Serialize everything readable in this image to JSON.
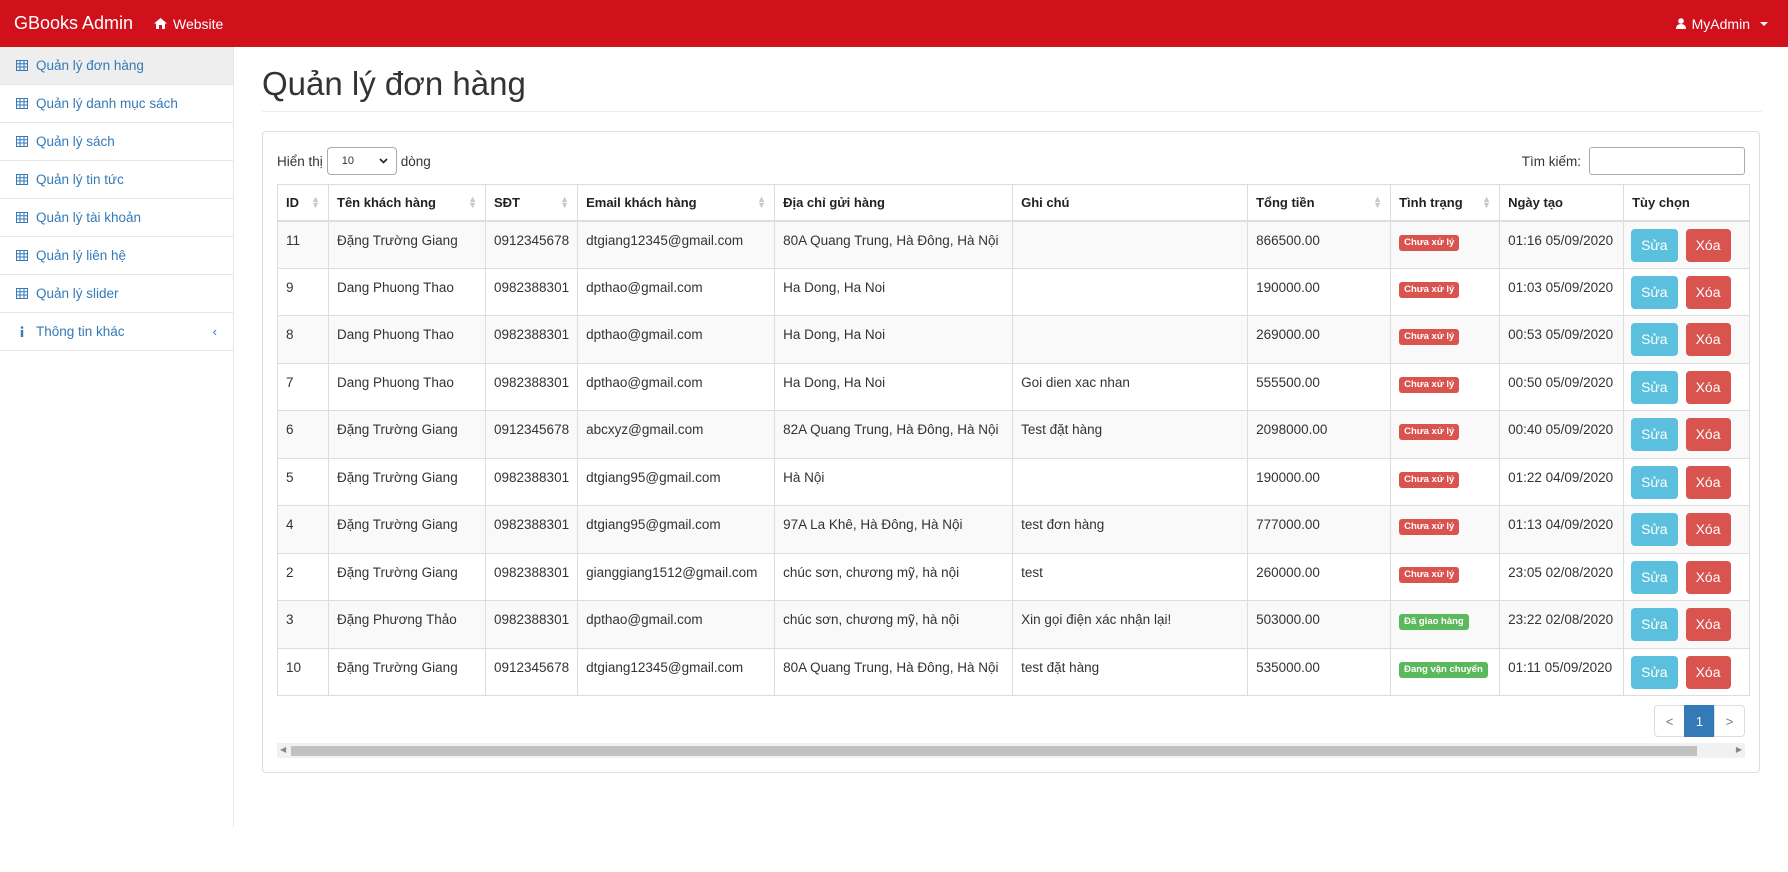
{
  "navbar": {
    "brand": "GBooks Admin",
    "website_label": "Website",
    "user_label": "MyAdmin"
  },
  "sidebar": {
    "items": [
      {
        "label": "Quản lý đơn hàng"
      },
      {
        "label": "Quản lý danh mục sách"
      },
      {
        "label": "Quản lý sách"
      },
      {
        "label": "Quản lý tin tức"
      },
      {
        "label": "Quản lý tài khoản"
      },
      {
        "label": "Quản lý liên hệ"
      },
      {
        "label": "Quản lý slider"
      },
      {
        "label": "Thông tin khác"
      }
    ]
  },
  "page": {
    "title": "Quản lý đơn hàng"
  },
  "table_controls": {
    "show_label": "Hiển thị",
    "length_value": "10",
    "rows_label": "dòng",
    "search_label": "Tìm kiếm:",
    "search_value": ""
  },
  "table": {
    "headers": [
      "ID",
      "Tên khách hàng",
      "SĐT",
      "Email khách hàng",
      "Địa chỉ gửi hàng",
      "Ghi chú",
      "Tổng tiền",
      "Tình trạng",
      "Ngày tạo",
      "Tùy chọn"
    ],
    "rows": [
      {
        "id": "11",
        "name": "Đặng Trường Giang",
        "phone": "0912345678",
        "email": "dtgiang12345@gmail.com",
        "address": "80A Quang Trung, Hà Đông, Hà Nội",
        "note": "",
        "total": "866500.00",
        "status": "Chưa xử lý",
        "status_color": "#d9534f",
        "date": "01:16 05/09/2020"
      },
      {
        "id": "9",
        "name": "Dang Phuong Thao",
        "phone": "0982388301",
        "email": "dpthao@gmail.com",
        "address": "Ha Dong, Ha Noi",
        "note": "",
        "total": "190000.00",
        "status": "Chưa xử lý",
        "status_color": "#d9534f",
        "date": "01:03 05/09/2020"
      },
      {
        "id": "8",
        "name": "Dang Phuong Thao",
        "phone": "0982388301",
        "email": "dpthao@gmail.com",
        "address": "Ha Dong, Ha Noi",
        "note": "",
        "total": "269000.00",
        "status": "Chưa xử lý",
        "status_color": "#d9534f",
        "date": "00:53 05/09/2020"
      },
      {
        "id": "7",
        "name": "Dang Phuong Thao",
        "phone": "0982388301",
        "email": "dpthao@gmail.com",
        "address": "Ha Dong, Ha Noi",
        "note": "Goi dien xac nhan",
        "total": "555500.00",
        "status": "Chưa xử lý",
        "status_color": "#d9534f",
        "date": "00:50 05/09/2020"
      },
      {
        "id": "6",
        "name": "Đặng Trường Giang",
        "phone": "0912345678",
        "email": "abcxyz@gmail.com",
        "address": "82A Quang Trung, Hà Đông, Hà Nội",
        "note": "Test đặt hàng",
        "total": "2098000.00",
        "status": "Chưa xử lý",
        "status_color": "#d9534f",
        "date": "00:40 05/09/2020"
      },
      {
        "id": "5",
        "name": "Đặng Trường Giang",
        "phone": "0982388301",
        "email": "dtgiang95@gmail.com",
        "address": "Hà Nội",
        "note": "",
        "total": "190000.00",
        "status": "Chưa xử lý",
        "status_color": "#d9534f",
        "date": "01:22 04/09/2020"
      },
      {
        "id": "4",
        "name": "Đặng Trường Giang",
        "phone": "0982388301",
        "email": "dtgiang95@gmail.com",
        "address": "97A La Khê, Hà Đông, Hà Nội",
        "note": "test đơn hàng",
        "total": "777000.00",
        "status": "Chưa xử lý",
        "status_color": "#d9534f",
        "date": "01:13 04/09/2020"
      },
      {
        "id": "2",
        "name": "Đặng Trường Giang",
        "phone": "0982388301",
        "email": "gianggiang1512@gmail.com",
        "address": "chúc sơn, chương mỹ, hà nội",
        "note": "test",
        "total": "260000.00",
        "status": "Chưa xử lý",
        "status_color": "#d9534f",
        "date": "23:05 02/08/2020"
      },
      {
        "id": "3",
        "name": "Đặng Phương Thảo",
        "phone": "0982388301",
        "email": "dpthao@gmail.com",
        "address": "chúc sơn, chương mỹ, hà nội",
        "note": "Xin gọi điện xác nhận lại!",
        "total": "503000.00",
        "status": "Đã giao hàng",
        "status_color": "#5cb85c",
        "date": "23:22 02/08/2020"
      },
      {
        "id": "10",
        "name": "Đặng Trường Giang",
        "phone": "0912345678",
        "email": "dtgiang12345@gmail.com",
        "address": "80A Quang Trung, Hà Đông, Hà Nội",
        "note": "test đặt hàng",
        "total": "535000.00",
        "status": "Đang vận chuyển",
        "status_color": "#5cb85c",
        "date": "01:11 05/09/2020"
      }
    ],
    "edit_label": "Sửa",
    "delete_label": "Xóa"
  },
  "pagination": {
    "prev": "<",
    "current": "1",
    "next": ">"
  },
  "icons": {
    "website": "home-icon",
    "user": "user-icon",
    "menu": "table-icon",
    "info": "info-icon",
    "collapse": "chevron-left-icon"
  }
}
